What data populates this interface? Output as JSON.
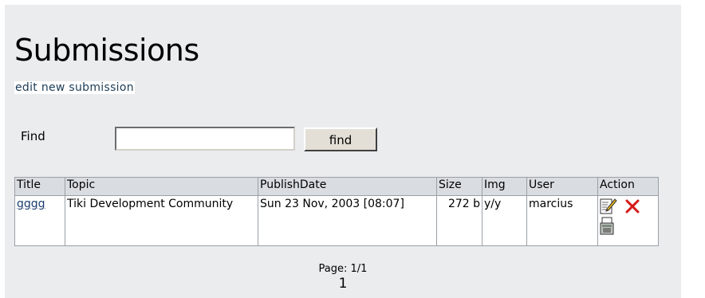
{
  "page": {
    "title": "Submissions",
    "edit_link": "edit new submission"
  },
  "search": {
    "label": "Find",
    "value": "",
    "button_label": "find"
  },
  "table": {
    "headers": {
      "title": "Title",
      "topic": "Topic",
      "publish_date": "PublishDate",
      "size": "Size",
      "img": "Img",
      "user": "User",
      "action": "Action"
    },
    "rows": [
      {
        "title": "gggg",
        "topic": "Tiki Development Community",
        "publish_date": "Sun 23 Nov, 2003 [08:07]",
        "size": "272 b",
        "img": "y/y",
        "user": "marcius",
        "actions": [
          "edit-icon",
          "remove-icon",
          "print-icon"
        ]
      }
    ]
  },
  "pagination": {
    "label": "Page: 1/1",
    "pages": [
      "1"
    ]
  },
  "colors": {
    "panel_bg": "#eaecee",
    "header_bg": "#d9dde2",
    "link": "#1a3d6d",
    "remove_icon": "#d61818"
  }
}
